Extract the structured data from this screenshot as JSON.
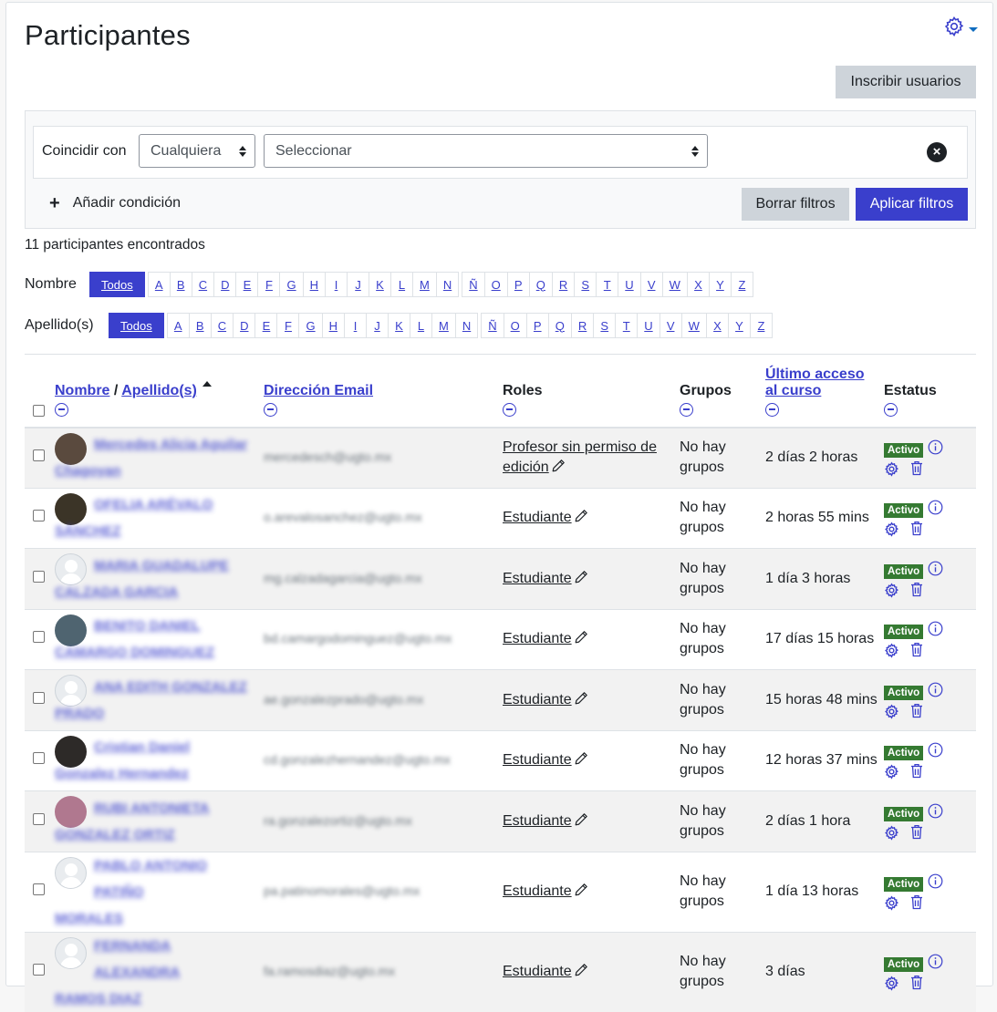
{
  "page": {
    "title": "Participantes"
  },
  "header": {
    "gear_icon": "gear-icon"
  },
  "enrol_button": "Inscribir usuarios",
  "filters": {
    "match_label": "Coincidir con",
    "match_value": "Cualquiera",
    "select_value": "Seleccionar",
    "add_condition": "Añadir condición",
    "clear": "Borrar filtros",
    "apply": "Aplicar filtros"
  },
  "count_text": "11 participantes encontrados",
  "initials": {
    "first_label": "Nombre",
    "last_label": "Apellido(s)",
    "all": "Todos",
    "letters": [
      "A",
      "B",
      "C",
      "D",
      "E",
      "F",
      "G",
      "H",
      "I",
      "J",
      "K",
      "L",
      "M",
      "N",
      "Ñ",
      "O",
      "P",
      "Q",
      "R",
      "S",
      "T",
      "U",
      "V",
      "W",
      "X",
      "Y",
      "Z"
    ]
  },
  "table": {
    "headers": {
      "first_name": "Nombre",
      "separator": "/",
      "last_name": "Apellido(s)",
      "email": "Dirección Email",
      "roles": "Roles",
      "groups": "Grupos",
      "last_access_1": "Último acceso",
      "last_access_2": "al curso",
      "status": "Estatus"
    },
    "rows": [
      {
        "name1": "Mercedes Alicia Aguilar",
        "name2": "Chagoyan",
        "email": "mercedesch@ugto.mx",
        "role_1": "Profesor sin permiso de",
        "role_2": "edición",
        "groups_1": "No hay",
        "groups_2": "grupos",
        "access": "2 días 2 horas",
        "status": "Activo",
        "avatar": "photo",
        "avatar_color": "#5a4a3e"
      },
      {
        "name1": "OFELIA ARÉVALO",
        "name2": "SÁNCHEZ",
        "email": "o.arevalosanchez@ugto.mx",
        "role_1": "Estudiante",
        "role_2": "",
        "groups_1": "No hay",
        "groups_2": "grupos",
        "access": "2 horas 55 mins",
        "status": "Activo",
        "avatar": "photo",
        "avatar_color": "#3b3427"
      },
      {
        "name1": "MARIA GUADALUPE",
        "name2": "CALZADA GARCIA",
        "email": "mg.calzadagarcia@ugto.mx",
        "role_1": "Estudiante",
        "role_2": "",
        "groups_1": "No hay",
        "groups_2": "grupos",
        "access": "1 día 3 horas",
        "status": "Activo",
        "avatar": "default",
        "avatar_color": "#e9ecef"
      },
      {
        "name1": "BENITO DANIEL",
        "name2": "CAMARGO DOMINGUEZ",
        "email": "bd.camargodominguez@ugto.mx",
        "role_1": "Estudiante",
        "role_2": "",
        "groups_1": "No hay",
        "groups_2": "grupos",
        "access": "17 días 15 horas",
        "status": "Activo",
        "avatar": "photo",
        "avatar_color": "#4f6470"
      },
      {
        "name1": "ANA EDITH GONZALEZ",
        "name2": "PRADO",
        "email": "ae.gonzalezprado@ugto.mx",
        "role_1": "Estudiante",
        "role_2": "",
        "groups_1": "No hay",
        "groups_2": "grupos",
        "access": "15 horas 48 mins",
        "status": "Activo",
        "avatar": "default",
        "avatar_color": "#e9ecef"
      },
      {
        "name1": "Cristian Daniel",
        "name2": "Gonzalez Hernandez",
        "email": "cd.gonzalezhernandez@ugto.mx",
        "role_1": "Estudiante",
        "role_2": "",
        "groups_1": "No hay",
        "groups_2": "grupos",
        "access": "12 horas 37 mins",
        "status": "Activo",
        "avatar": "photo",
        "avatar_color": "#2d2a28"
      },
      {
        "name1": "RUBI ANTONIETA",
        "name2": "GONZALEZ ORTIZ",
        "email": "ra.gonzalezortiz@ugto.mx",
        "role_1": "Estudiante",
        "role_2": "",
        "groups_1": "No hay",
        "groups_2": "grupos",
        "access": "2 días 1 hora",
        "status": "Activo",
        "avatar": "photo",
        "avatar_color": "#b0788f"
      },
      {
        "name1": "PABLO ANTONIO PATIÑO",
        "name2": "MORALES",
        "email": "pa.patinomorales@ugto.mx",
        "role_1": "Estudiante",
        "role_2": "",
        "groups_1": "No hay",
        "groups_2": "grupos",
        "access": "1 día 13 horas",
        "status": "Activo",
        "avatar": "default",
        "avatar_color": "#e9ecef"
      },
      {
        "name1": "FERNANDA ALEXANDRA",
        "name2": "RAMOS DIAZ",
        "email": "fa.ramosdiaz@ugto.mx",
        "role_1": "Estudiante",
        "role_2": "",
        "groups_1": "No hay",
        "groups_2": "grupos",
        "access": "3 días",
        "status": "Activo",
        "avatar": "default",
        "avatar_color": "#e9ecef"
      }
    ]
  },
  "colors": {
    "primary": "#3a3fcc",
    "active_badge": "#357a32",
    "secondary_btn": "#ced4da"
  }
}
